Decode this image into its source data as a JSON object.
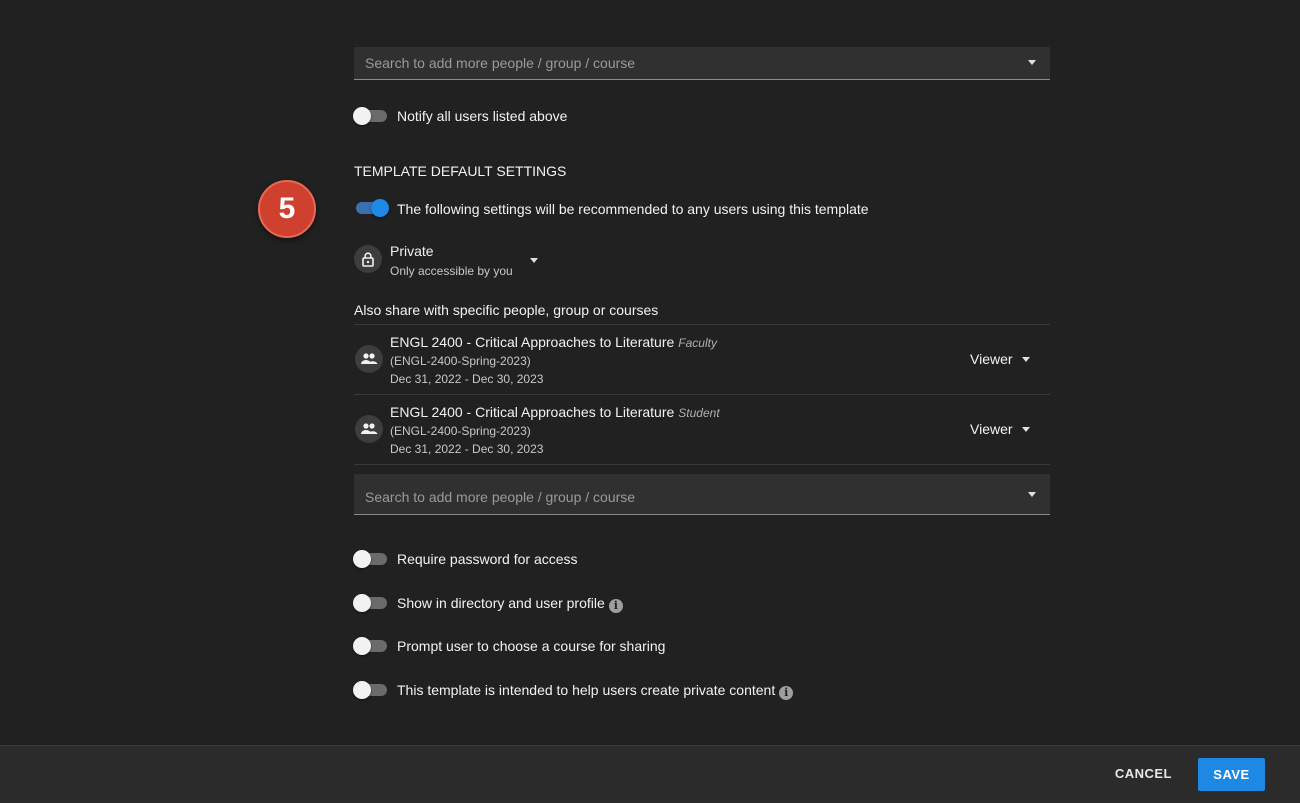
{
  "top_search": {
    "placeholder": "Search to add more people / group / course"
  },
  "notify": {
    "label": "Notify all users listed above",
    "enabled": false
  },
  "step_badge": "5",
  "template_defaults": {
    "heading": "TEMPLATE DEFAULT SETTINGS",
    "recommend_label": "The following settings will be recommended to any users using this template",
    "recommend_enabled": true,
    "visibility": {
      "title": "Private",
      "subtitle": "Only accessible by you",
      "icon": "lock-icon"
    },
    "share_heading": "Also share with specific people, group or courses",
    "shares": [
      {
        "title": "ENGL 2400 - Critical Approaches to Literature",
        "role_tag": "Faculty",
        "code": "(ENGL-2400-Spring-2023)",
        "dates": "Dec 31, 2022 - Dec 30, 2023",
        "permission": "Viewer",
        "icon": "group-icon"
      },
      {
        "title": "ENGL 2400 - Critical Approaches to Literature",
        "role_tag": "Student",
        "code": "(ENGL-2400-Spring-2023)",
        "dates": "Dec 31, 2022 - Dec 30, 2023",
        "permission": "Viewer",
        "icon": "group-icon"
      }
    ],
    "bottom_search": {
      "placeholder": "Search to add more people / group / course"
    },
    "options": [
      {
        "label": "Require password for access",
        "enabled": false,
        "info": false
      },
      {
        "label": "Show in directory and user profile",
        "enabled": false,
        "info": true
      },
      {
        "label": "Prompt user to choose a course for sharing",
        "enabled": false,
        "info": false
      },
      {
        "label": "This template is intended to help users create private content",
        "enabled": false,
        "info": true
      }
    ]
  },
  "footer": {
    "cancel_label": "CANCEL",
    "save_label": "SAVE"
  },
  "colors": {
    "accent": "#1e88e5",
    "badge": "#d0402e",
    "background": "#212121"
  }
}
